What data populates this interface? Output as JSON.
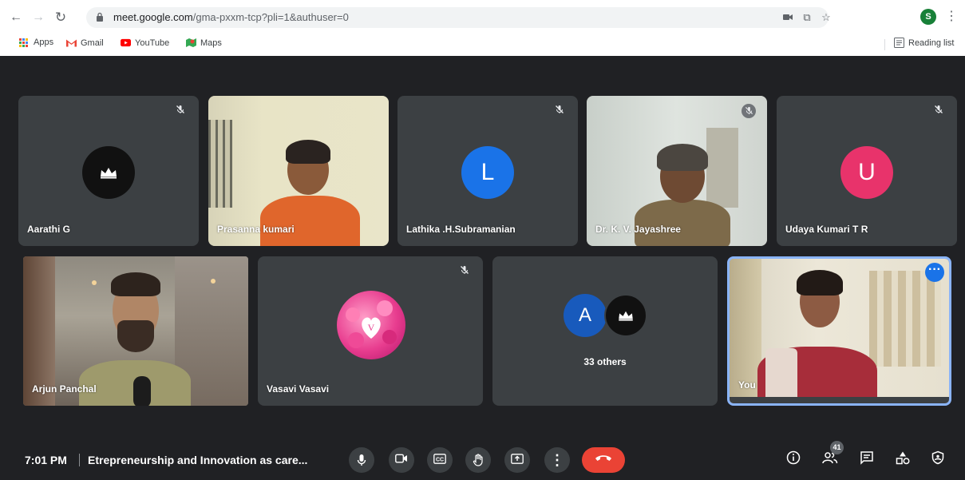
{
  "browser": {
    "url_host": "meet.google.com",
    "url_rest": "/gma-pxxm-tcp?pli=1&authuser=0",
    "profile_initial": "S",
    "bookmarks": [
      {
        "label": "Apps",
        "icon": "apps-grid-icon"
      },
      {
        "label": "Gmail",
        "icon": "gmail-icon"
      },
      {
        "label": "YouTube",
        "icon": "youtube-icon"
      },
      {
        "label": "Maps",
        "icon": "maps-icon"
      }
    ],
    "reading_list": "Reading list"
  },
  "participants": {
    "aarathi": "Aarathi G",
    "prasanna": "Prasanna kumari",
    "lathika": "Lathika .H.Subramanian",
    "lathika_initial": "L",
    "jayashree": "Dr. K. V. Jayashree",
    "udaya": "Udaya Kumari T R",
    "udaya_initial": "U",
    "arjun": "Arjun Panchal",
    "vasavi": "Vasavi Vasavi",
    "others_initial": "A",
    "others_label": "33 others",
    "you": "You"
  },
  "bottom_bar": {
    "time": "7:01 PM",
    "meeting_title": "Etrepreneurship and Innovation as care...",
    "people_count": "41"
  },
  "colors": {
    "meet_bg": "#202124",
    "tile_bg": "#3c4043",
    "end_call": "#ea4335",
    "lathika_avatar": "#1a73e8",
    "udaya_avatar": "#e8336b",
    "others_avatar": "#185abc",
    "active_border": "#8ab4f8"
  }
}
